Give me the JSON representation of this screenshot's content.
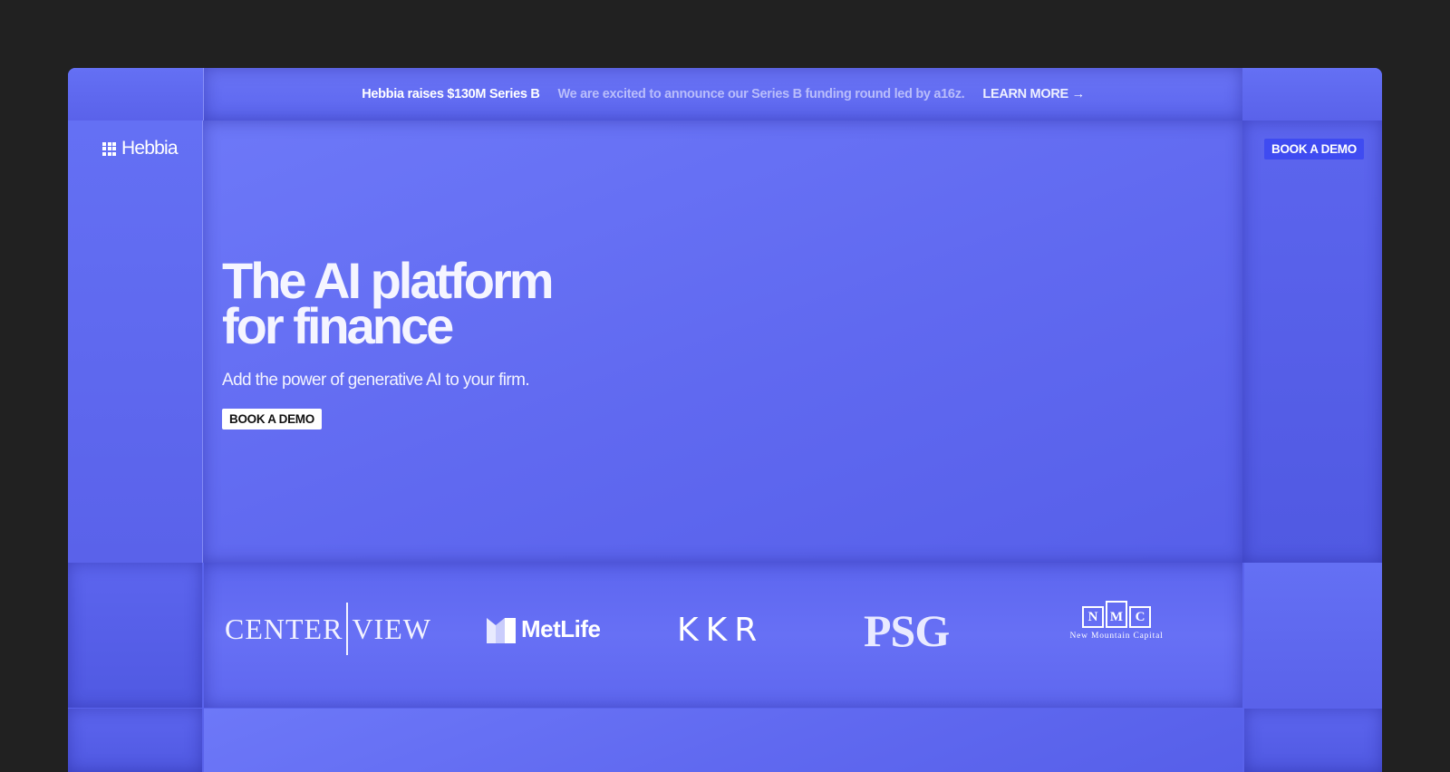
{
  "banner": {
    "title": "Hebbia raises $130M Series B",
    "description": "We are excited to announce our Series B funding round led by a16z.",
    "link_label": "LEARN MORE →"
  },
  "header": {
    "logo_text": "Hebbia",
    "book_demo_label": "BOOK A DEMO"
  },
  "hero": {
    "title": "The AI platform\nfor finance",
    "subtitle": "Add the power of generative AI to your firm.",
    "cta_label": "BOOK A DEMO"
  },
  "clients": {
    "centerview_left": "CENTER",
    "centerview_right": "VIEW",
    "metlife": "MetLife",
    "kkr": "KKR",
    "psg": "PSG",
    "nmc_letters": [
      "N",
      "M",
      "C"
    ],
    "nmc_caption": "New Mountain Capital"
  },
  "colors": {
    "background": "#212121",
    "brand_blue": "#5a63ec",
    "button_blue": "#3f4bf1"
  }
}
